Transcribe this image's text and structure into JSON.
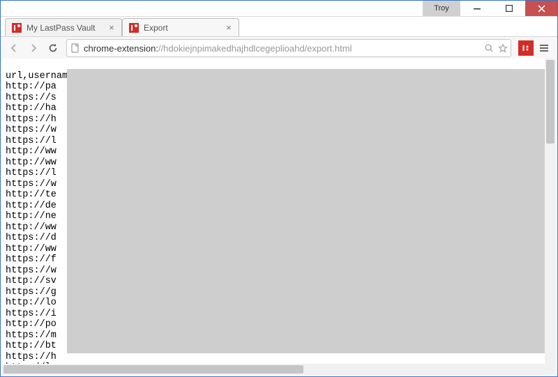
{
  "window": {
    "user_label": "Troy"
  },
  "tabs": [
    {
      "label": "My LastPass Vault",
      "active": false
    },
    {
      "label": "Export",
      "active": true
    }
  ],
  "address_bar": {
    "scheme": "chrome-extension:",
    "rest": "//hdokiejnpimakedhajhdlcegeplioahd/export.html"
  },
  "page": {
    "header_line": "url,username,password,extra,name,grouping,fav",
    "lines": [
      "http://pa",
      "https://s",
      "http://ha",
      "https://h",
      "https://w",
      "https://l",
      "http://ww",
      "http://ww",
      "https://l",
      "https://w",
      "http://te",
      "http://de",
      "http://ne",
      "http://ww",
      "https://d",
      "http://ww",
      "https://f",
      "https://w",
      "http://sv",
      "https://g",
      "http://lo",
      "https://i",
      "http://po",
      "https://m",
      "http://bt",
      "https://h",
      "http://lo"
    ]
  }
}
